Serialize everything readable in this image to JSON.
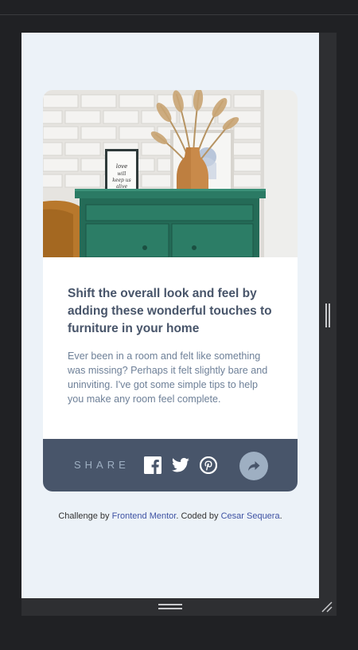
{
  "card": {
    "title": "Shift the overall look and feel by adding these wonderful touches to furniture in your home",
    "text": "Ever been in a room and felt like something was missing? Perhaps it felt slightly bare and uninviting. I've got some simple tips to help you make any room feel complete."
  },
  "share": {
    "label": "SHARE",
    "icons": [
      "facebook-icon",
      "twitter-icon",
      "pinterest-icon",
      "share-arrow-icon"
    ]
  },
  "attribution": {
    "prefix": "Challenge by ",
    "link1": "Frontend Mentor",
    "middle": ". Coded by ",
    "link2": "Cesar Sequera",
    "suffix": "."
  },
  "colors": {
    "page_bg": "#ecf2f8",
    "heading": "#48556a",
    "body_text": "#6e8098",
    "share_bar": "#48556a",
    "share_button": "#9eafc2",
    "link": "#3e52a3",
    "devtools_bg": "#202124"
  }
}
